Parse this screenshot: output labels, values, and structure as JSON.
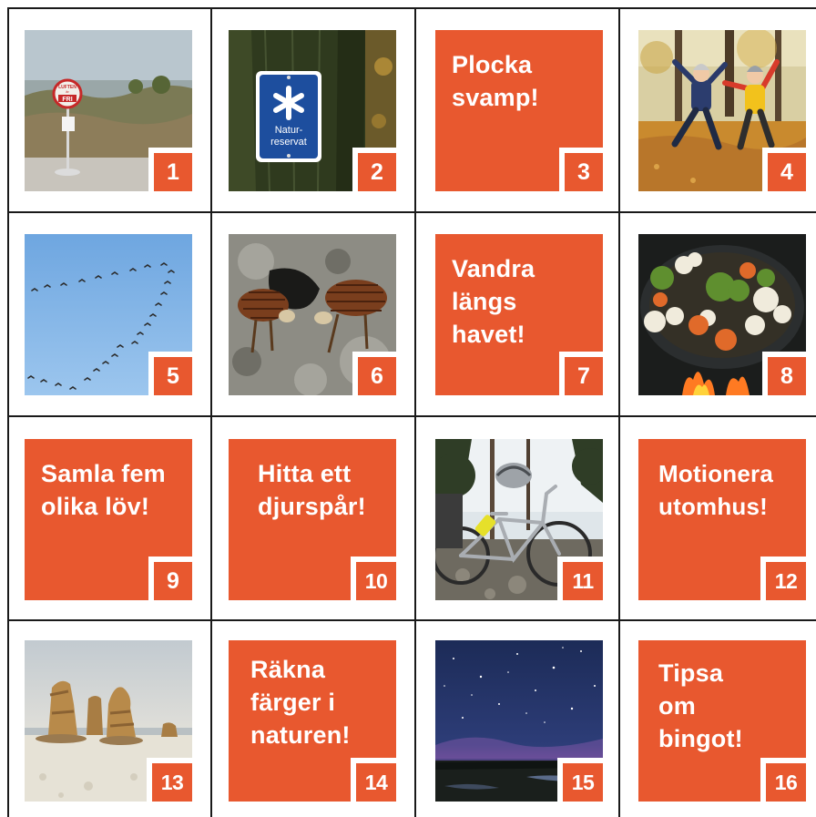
{
  "colors": {
    "accent": "#e8582f",
    "grid": "#1a1a1a",
    "background": "#ffffff"
  },
  "tiles": [
    {
      "number": "1",
      "kind": "photo",
      "image": "coastal heath with round red sign on a post",
      "sign_text": [
        "LUFTEN",
        "är",
        "FRI"
      ]
    },
    {
      "number": "2",
      "kind": "photo",
      "image": "blue nature-reserve sign on a tree trunk",
      "sign_text": [
        "Natur-",
        "reservat"
      ]
    },
    {
      "number": "3",
      "kind": "text",
      "text": "Plocka\nsvamp!"
    },
    {
      "number": "4",
      "kind": "photo",
      "image": "two children jumping in autumn leaves"
    },
    {
      "number": "5",
      "kind": "photo",
      "image": "flock of geese in V-formation on blue sky"
    },
    {
      "number": "6",
      "kind": "photo",
      "image": "two pine cone animals on a rock"
    },
    {
      "number": "7",
      "kind": "text",
      "text": "Vandra\nlängs\nhavet!"
    },
    {
      "number": "8",
      "kind": "photo",
      "image": "vegetables cooking in a pan over a campfire"
    },
    {
      "number": "9",
      "kind": "text",
      "text": "Samla fem\nolika löv!"
    },
    {
      "number": "10",
      "kind": "text",
      "text": "Hitta ett\ndjurspår!"
    },
    {
      "number": "11",
      "kind": "photo",
      "image": "bicycle with helmet in a pine forest"
    },
    {
      "number": "12",
      "kind": "text",
      "text": "Motionera\nutomhus!"
    },
    {
      "number": "13",
      "kind": "photo",
      "image": "limestone sea stacks on a pebble beach"
    },
    {
      "number": "14",
      "kind": "text",
      "text": "Räkna\nfärger i\nnaturen!"
    },
    {
      "number": "15",
      "kind": "photo",
      "image": "starry night sky over a wetland"
    },
    {
      "number": "16",
      "kind": "text",
      "text": "Tipsa\nom\nbingot!"
    }
  ]
}
